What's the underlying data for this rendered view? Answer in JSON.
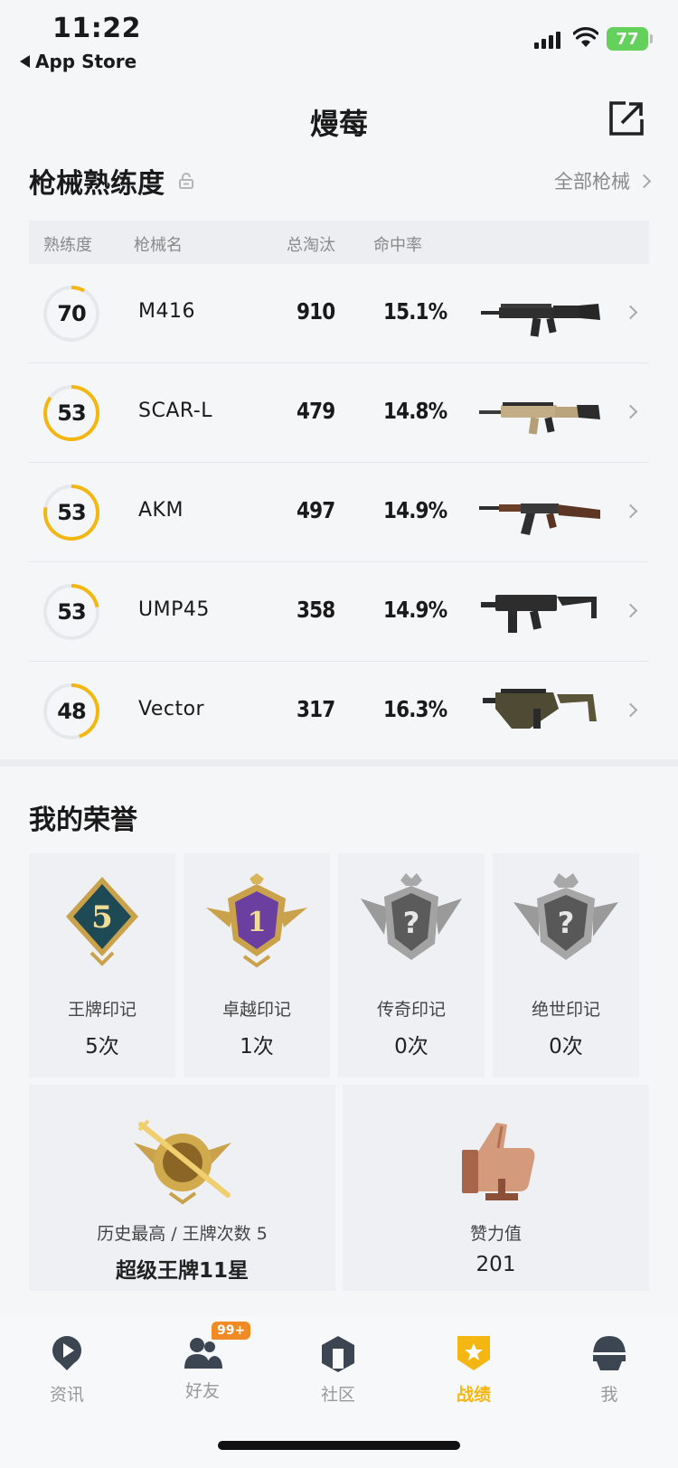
{
  "status_bar": {
    "time": "11:22",
    "back_app": "App Store",
    "battery": "77"
  },
  "header": {
    "title": "熳莓"
  },
  "weapons": {
    "section_title": "枪械熟练度",
    "all_link": "全部枪械",
    "columns": {
      "mastery": "熟练度",
      "name": "枪械名",
      "kills": "总淘汰",
      "accuracy": "命中率"
    },
    "rows": [
      {
        "level": "70",
        "name": "M416",
        "kills": "910",
        "accuracy": "15.1%",
        "progress": 0.08
      },
      {
        "level": "53",
        "name": "SCAR-L",
        "kills": "479",
        "accuracy": "14.8%",
        "progress": 0.85
      },
      {
        "level": "53",
        "name": "AKM",
        "kills": "497",
        "accuracy": "14.9%",
        "progress": 0.78
      },
      {
        "level": "53",
        "name": "UMP45",
        "kills": "358",
        "accuracy": "14.9%",
        "progress": 0.22
      },
      {
        "level": "48",
        "name": "Vector",
        "kills": "317",
        "accuracy": "16.3%",
        "progress": 0.45
      }
    ]
  },
  "honors": {
    "section_title": "我的荣誉",
    "marks": [
      {
        "label": "王牌印记",
        "count": "5次",
        "icon": "ace-mark-icon"
      },
      {
        "label": "卓越印记",
        "count": "1次",
        "icon": "excellence-mark-icon"
      },
      {
        "label": "传奇印记",
        "count": "0次",
        "icon": "legend-mark-icon"
      },
      {
        "label": "绝世印记",
        "count": "0次",
        "icon": "peerless-mark-icon"
      }
    ],
    "highest": {
      "label": "历史最高 / 王牌次数 5",
      "value": "超级王牌11星"
    },
    "likes": {
      "label": "赞力值",
      "value": "201"
    }
  },
  "nav": {
    "items": [
      {
        "label": "资讯"
      },
      {
        "label": "好友",
        "badge": "99+"
      },
      {
        "label": "社区"
      },
      {
        "label": "战绩"
      },
      {
        "label": "我"
      }
    ],
    "active_index": 3
  },
  "colors": {
    "accent": "#f4b711",
    "badge": "#f08a24",
    "battery": "#65d15d"
  }
}
